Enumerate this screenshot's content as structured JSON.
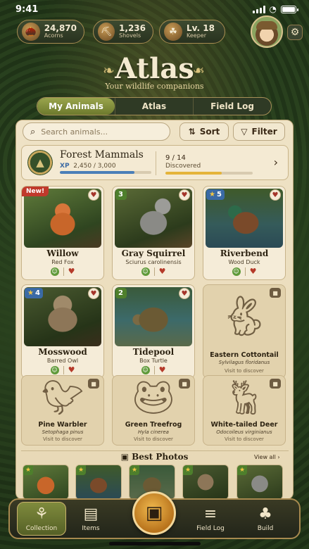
{
  "status": {
    "time": "9:41"
  },
  "resources": [
    {
      "value": "24,870",
      "label": "Acorns",
      "icon": "acorn-icon"
    },
    {
      "value": "1,236",
      "label": "Shovels",
      "icon": "shovel-icon"
    },
    {
      "value": "Lv. 18",
      "label": "Keeper",
      "icon": "leaf-icon"
    }
  ],
  "header": {
    "title": "Atlas",
    "subtitle": "Your wildlife companions"
  },
  "tabs": [
    "My Animals",
    "Atlas",
    "Field Log"
  ],
  "search": {
    "placeholder": "Search animals..."
  },
  "toolbar": {
    "sort": "Sort",
    "filter": "Filter"
  },
  "collection": {
    "title": "Forest Mammals",
    "xp_label": "XP",
    "xp_text": "2,450 / 3,000",
    "xp_fraction": 0.8167,
    "count": "9 / 14",
    "count_label": "Discovered",
    "discovered_fraction": 0.6429
  },
  "animals": [
    {
      "name": "Willow",
      "species": "Red Fox",
      "tag": "New!",
      "level": "",
      "starred": false
    },
    {
      "name": "Gray Squirrel",
      "species": "Sciurus carolinensis",
      "tag": "",
      "level": "3",
      "starred": false
    },
    {
      "name": "Riverbend",
      "species": "Wood Duck",
      "tag": "",
      "level": "5",
      "starred": true
    },
    {
      "name": "Mosswood",
      "species": "Barred Owl",
      "tag": "",
      "level": "4",
      "starred": true
    },
    {
      "name": "Tidepool",
      "species": "Box Turtle",
      "tag": "",
      "level": "2",
      "starred": false
    }
  ],
  "locked": [
    {
      "name": "Eastern Cottontail",
      "species": "Sylvilagus floridanus",
      "hint": "Visit to discover"
    },
    {
      "name": "Pine Warbler",
      "species": "Setophaga pinus",
      "hint": "Visit to discover"
    },
    {
      "name": "Green Treefrog",
      "species": "Hyla cinerea",
      "hint": "Visit to discover"
    },
    {
      "name": "White-tailed Deer",
      "species": "Odocoileus virginianus",
      "hint": "Visit to discover"
    }
  ],
  "best_photos": {
    "title": "Best Photos",
    "view_all": "View all"
  },
  "nav": [
    "Collection",
    "Items",
    "Field Log",
    "Build"
  ],
  "colors": {
    "accent": "#7f8b3d",
    "parchment": "#efe3c6",
    "heart": "#b53a2a",
    "gold": "#a98d52"
  }
}
